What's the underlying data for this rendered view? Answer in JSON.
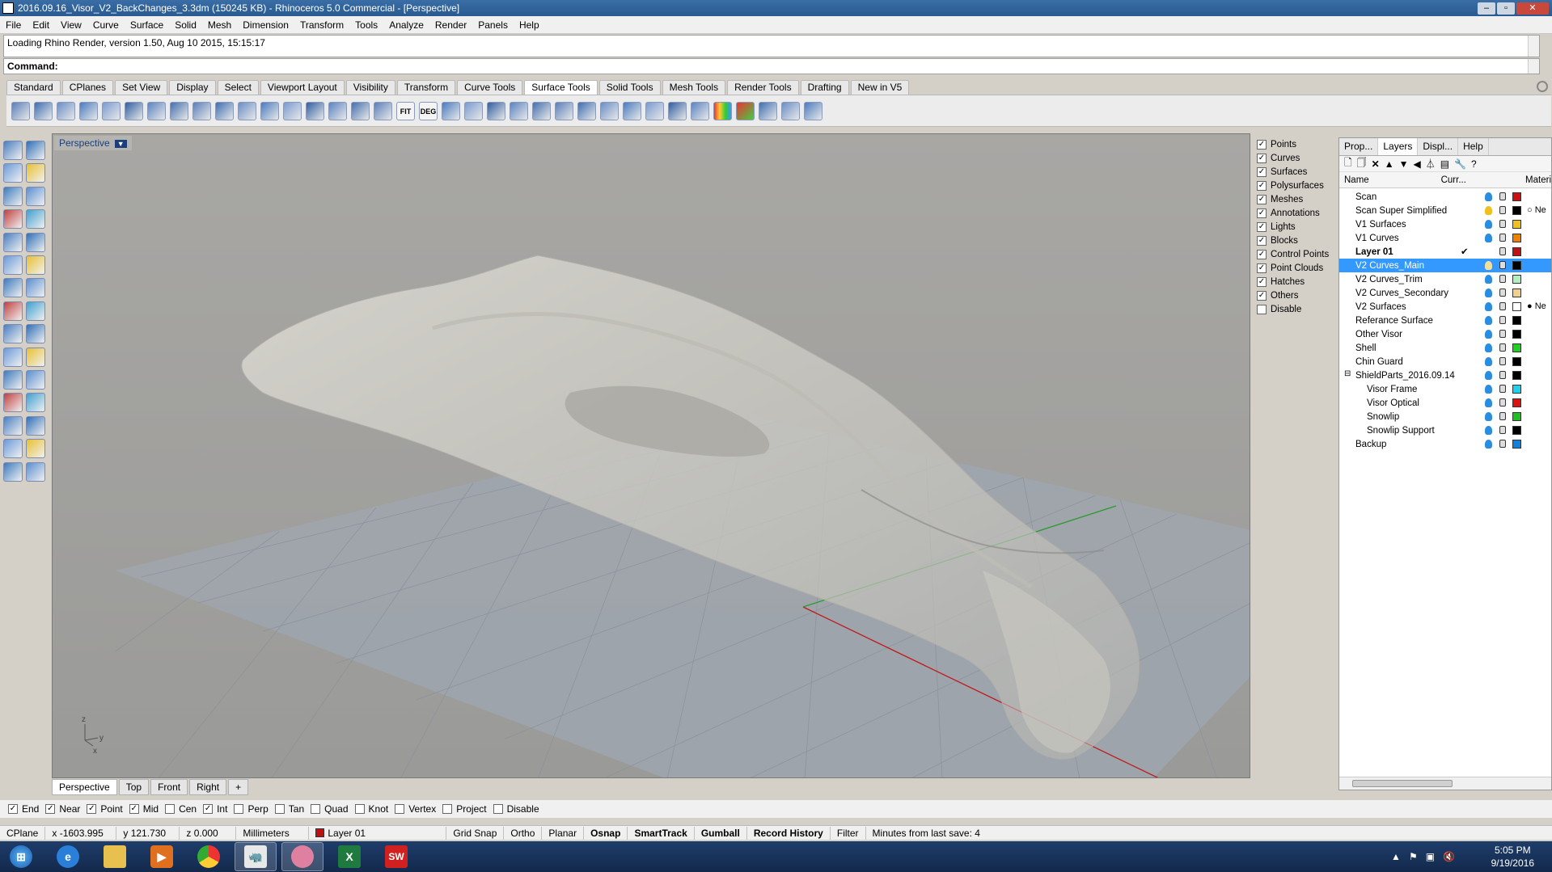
{
  "window": {
    "title": "2016.09.16_Visor_V2_BackChanges_3.3dm (150245 KB) - Rhinoceros 5.0 Commercial - [Perspective]"
  },
  "menu": [
    "File",
    "Edit",
    "View",
    "Curve",
    "Surface",
    "Solid",
    "Mesh",
    "Dimension",
    "Transform",
    "Tools",
    "Analyze",
    "Render",
    "Panels",
    "Help"
  ],
  "command": {
    "history": "Loading Rhino Render, version 1.50, Aug 10 2015, 15:15:17",
    "prompt": "Command:"
  },
  "toolbar_tabs": [
    "Standard",
    "CPlanes",
    "Set View",
    "Display",
    "Select",
    "Viewport Layout",
    "Visibility",
    "Transform",
    "Curve Tools",
    "Surface Tools",
    "Solid Tools",
    "Mesh Tools",
    "Render Tools",
    "Drafting",
    "New in V5"
  ],
  "toolbar_active_tab": "Surface Tools",
  "toolbar_text_icons": [
    "FIT",
    "DEG"
  ],
  "viewport": {
    "label": "Perspective",
    "axis_z": "z",
    "axis_y": "y",
    "axis_x": "x"
  },
  "view_tabs": [
    "Perspective",
    "Top",
    "Front",
    "Right"
  ],
  "view_tab_add": "+",
  "filter": [
    {
      "label": "Points",
      "checked": true
    },
    {
      "label": "Curves",
      "checked": true
    },
    {
      "label": "Surfaces",
      "checked": true
    },
    {
      "label": "Polysurfaces",
      "checked": true
    },
    {
      "label": "Meshes",
      "checked": true
    },
    {
      "label": "Annotations",
      "checked": true
    },
    {
      "label": "Lights",
      "checked": true
    },
    {
      "label": "Blocks",
      "checked": true
    },
    {
      "label": "Control Points",
      "checked": true
    },
    {
      "label": "Point Clouds",
      "checked": true
    },
    {
      "label": "Hatches",
      "checked": true
    },
    {
      "label": "Others",
      "checked": true
    },
    {
      "label": "Disable",
      "checked": false
    }
  ],
  "panel_tabs": [
    "Prop...",
    "Layers",
    "Displ...",
    "Help"
  ],
  "layers_header": {
    "name": "Name",
    "current": "Curr...",
    "material": "Materi"
  },
  "layers": [
    {
      "name": "Scan",
      "color": "#d01010",
      "bulb": "#2a8de0"
    },
    {
      "name": "Scan Super Simplified",
      "color": "#000000",
      "bulb": "#f0c020",
      "mat": "○ Ne"
    },
    {
      "name": "V1 Surfaces",
      "color": "#f0c020",
      "bulb": "#2a8de0"
    },
    {
      "name": "V1 Curves",
      "color": "#f08000",
      "bulb": "#2a8de0"
    },
    {
      "name": "Layer 01",
      "color": "#c01010",
      "bulb": "transparent",
      "bold": true,
      "current": "✔"
    },
    {
      "name": "V2 Curves_Main",
      "color": "#000000",
      "bulb": "#f0e0a0",
      "selected": true
    },
    {
      "name": "V2 Curves_Trim",
      "color": "#b0f0c0",
      "bulb": "#2a8de0"
    },
    {
      "name": "V2 Curves_Secondary",
      "color": "#f0d090",
      "bulb": "#2a8de0"
    },
    {
      "name": "V2 Surfaces",
      "color": "#ffffff",
      "bulb": "#2a8de0",
      "mat": "● Ne"
    },
    {
      "name": "Referance Surface",
      "color": "#000000",
      "bulb": "#2a8de0"
    },
    {
      "name": "Other Visor",
      "color": "#000000",
      "bulb": "#2a8de0"
    },
    {
      "name": "Shell",
      "color": "#20d020",
      "bulb": "#2a8de0"
    },
    {
      "name": "Chin Guard",
      "color": "#000000",
      "bulb": "#2a8de0"
    },
    {
      "name": "ShieldParts_2016.09.14",
      "color": "#000000",
      "bulb": "#2a8de0",
      "expander": "⊟"
    },
    {
      "name": "Visor Frame",
      "color": "#20d0f0",
      "bulb": "#2a8de0",
      "indent": true
    },
    {
      "name": "Visor Optical",
      "color": "#e01010",
      "bulb": "#2a8de0",
      "indent": true
    },
    {
      "name": "Snowlip",
      "color": "#20c020",
      "bulb": "#2a8de0",
      "indent": true
    },
    {
      "name": "Snowlip Support",
      "color": "#000000",
      "bulb": "#2a8de0",
      "indent": true
    },
    {
      "name": "Backup",
      "color": "#1080e0",
      "bulb": "#2a8de0"
    }
  ],
  "osnap": [
    {
      "label": "End",
      "checked": true
    },
    {
      "label": "Near",
      "checked": true
    },
    {
      "label": "Point",
      "checked": true
    },
    {
      "label": "Mid",
      "checked": true
    },
    {
      "label": "Cen",
      "checked": false
    },
    {
      "label": "Int",
      "checked": true
    },
    {
      "label": "Perp",
      "checked": false
    },
    {
      "label": "Tan",
      "checked": false
    },
    {
      "label": "Quad",
      "checked": false
    },
    {
      "label": "Knot",
      "checked": false
    },
    {
      "label": "Vertex",
      "checked": false
    },
    {
      "label": "Project",
      "checked": false
    },
    {
      "label": "Disable",
      "checked": false
    }
  ],
  "status": {
    "cplane": "CPlane",
    "x": "x -1603.995",
    "y": "y 121.730",
    "z": "z 0.000",
    "units": "Millimeters",
    "layer": "Layer 01",
    "layer_color": "#c01010",
    "grid_snap": "Grid Snap",
    "ortho": "Ortho",
    "planar": "Planar",
    "osnap": "Osnap",
    "smarttrack": "SmartTrack",
    "gumball": "Gumball",
    "record_history": "Record History",
    "filter": "Filter",
    "save": "Minutes from last save: 4"
  },
  "taskbar": {
    "time": "5:05 PM",
    "date": "9/19/2016",
    "sw_label": "SW"
  }
}
